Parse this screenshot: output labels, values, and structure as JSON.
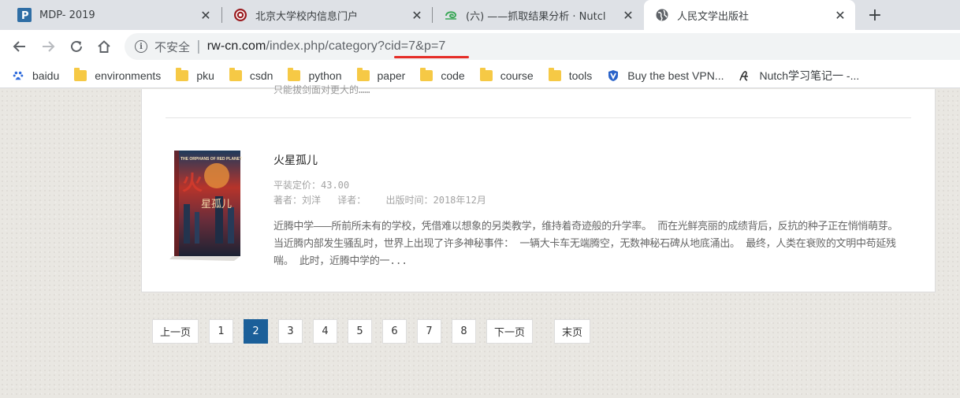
{
  "tabs": [
    {
      "title": "MDP- 2019",
      "icon": "p-logo-icon",
      "active": false
    },
    {
      "title": "北京大学校内信息门户",
      "icon": "pku-seal-icon",
      "active": false
    },
    {
      "title": "(六) ——抓取结果分析 · Nutcl",
      "icon": "green-swirl-icon",
      "active": false
    },
    {
      "title": "人民文学出版社",
      "icon": "globe-icon",
      "active": true
    }
  ],
  "toolbar": {
    "insecure_label": "不安全",
    "url_host": "rw-cn.com",
    "url_path": "/index.php/category?cid=7&p=7"
  },
  "bookmarks": [
    {
      "label": "baidu",
      "icon": "baidu-paw-icon"
    },
    {
      "label": "environments",
      "icon": "folder-icon"
    },
    {
      "label": "pku",
      "icon": "folder-icon"
    },
    {
      "label": "csdn",
      "icon": "folder-icon"
    },
    {
      "label": "python",
      "icon": "folder-icon"
    },
    {
      "label": "paper",
      "icon": "folder-icon"
    },
    {
      "label": "code",
      "icon": "folder-icon"
    },
    {
      "label": "course",
      "icon": "folder-icon"
    },
    {
      "label": "tools",
      "icon": "folder-icon"
    },
    {
      "label": "Buy the best VPN...",
      "icon": "shield-v-icon"
    },
    {
      "label": "Nutch学习笔记一 -...",
      "icon": "script-a-icon"
    }
  ],
  "book": {
    "title": "火星孤儿",
    "price": "平装定价：43.00",
    "author": "著者：刘洋",
    "translator": "译者：",
    "published": "出版时间：2018年12月",
    "description": "近腾中学———所前所未有的学校，凭借难以想象的另类教学，维持着奇迹般的升学率。 而在光鲜亮丽的成绩背后，反抗的种子正在悄悄萌芽。 当近腾内部发生骚乱时，世界上出现了许多神秘事件： 一辆大卡车无端腾空，无数神秘石碑从地底涌出。 最终，人类在衰败的文明中苟延残喘。 此时，近腾中学的一...",
    "cover_text": "THE ORPHANS OF RED PLANET",
    "previous_cut_text": "只能拔剑面对更大的……"
  },
  "pagination": {
    "prev": "上一页",
    "pages": [
      "1",
      "2",
      "3",
      "4",
      "5",
      "6",
      "7",
      "8"
    ],
    "current": "2",
    "next": "下一页",
    "last": "末页"
  },
  "colors": {
    "accent": "#1b5f99",
    "url_underline": "#e52d27"
  }
}
